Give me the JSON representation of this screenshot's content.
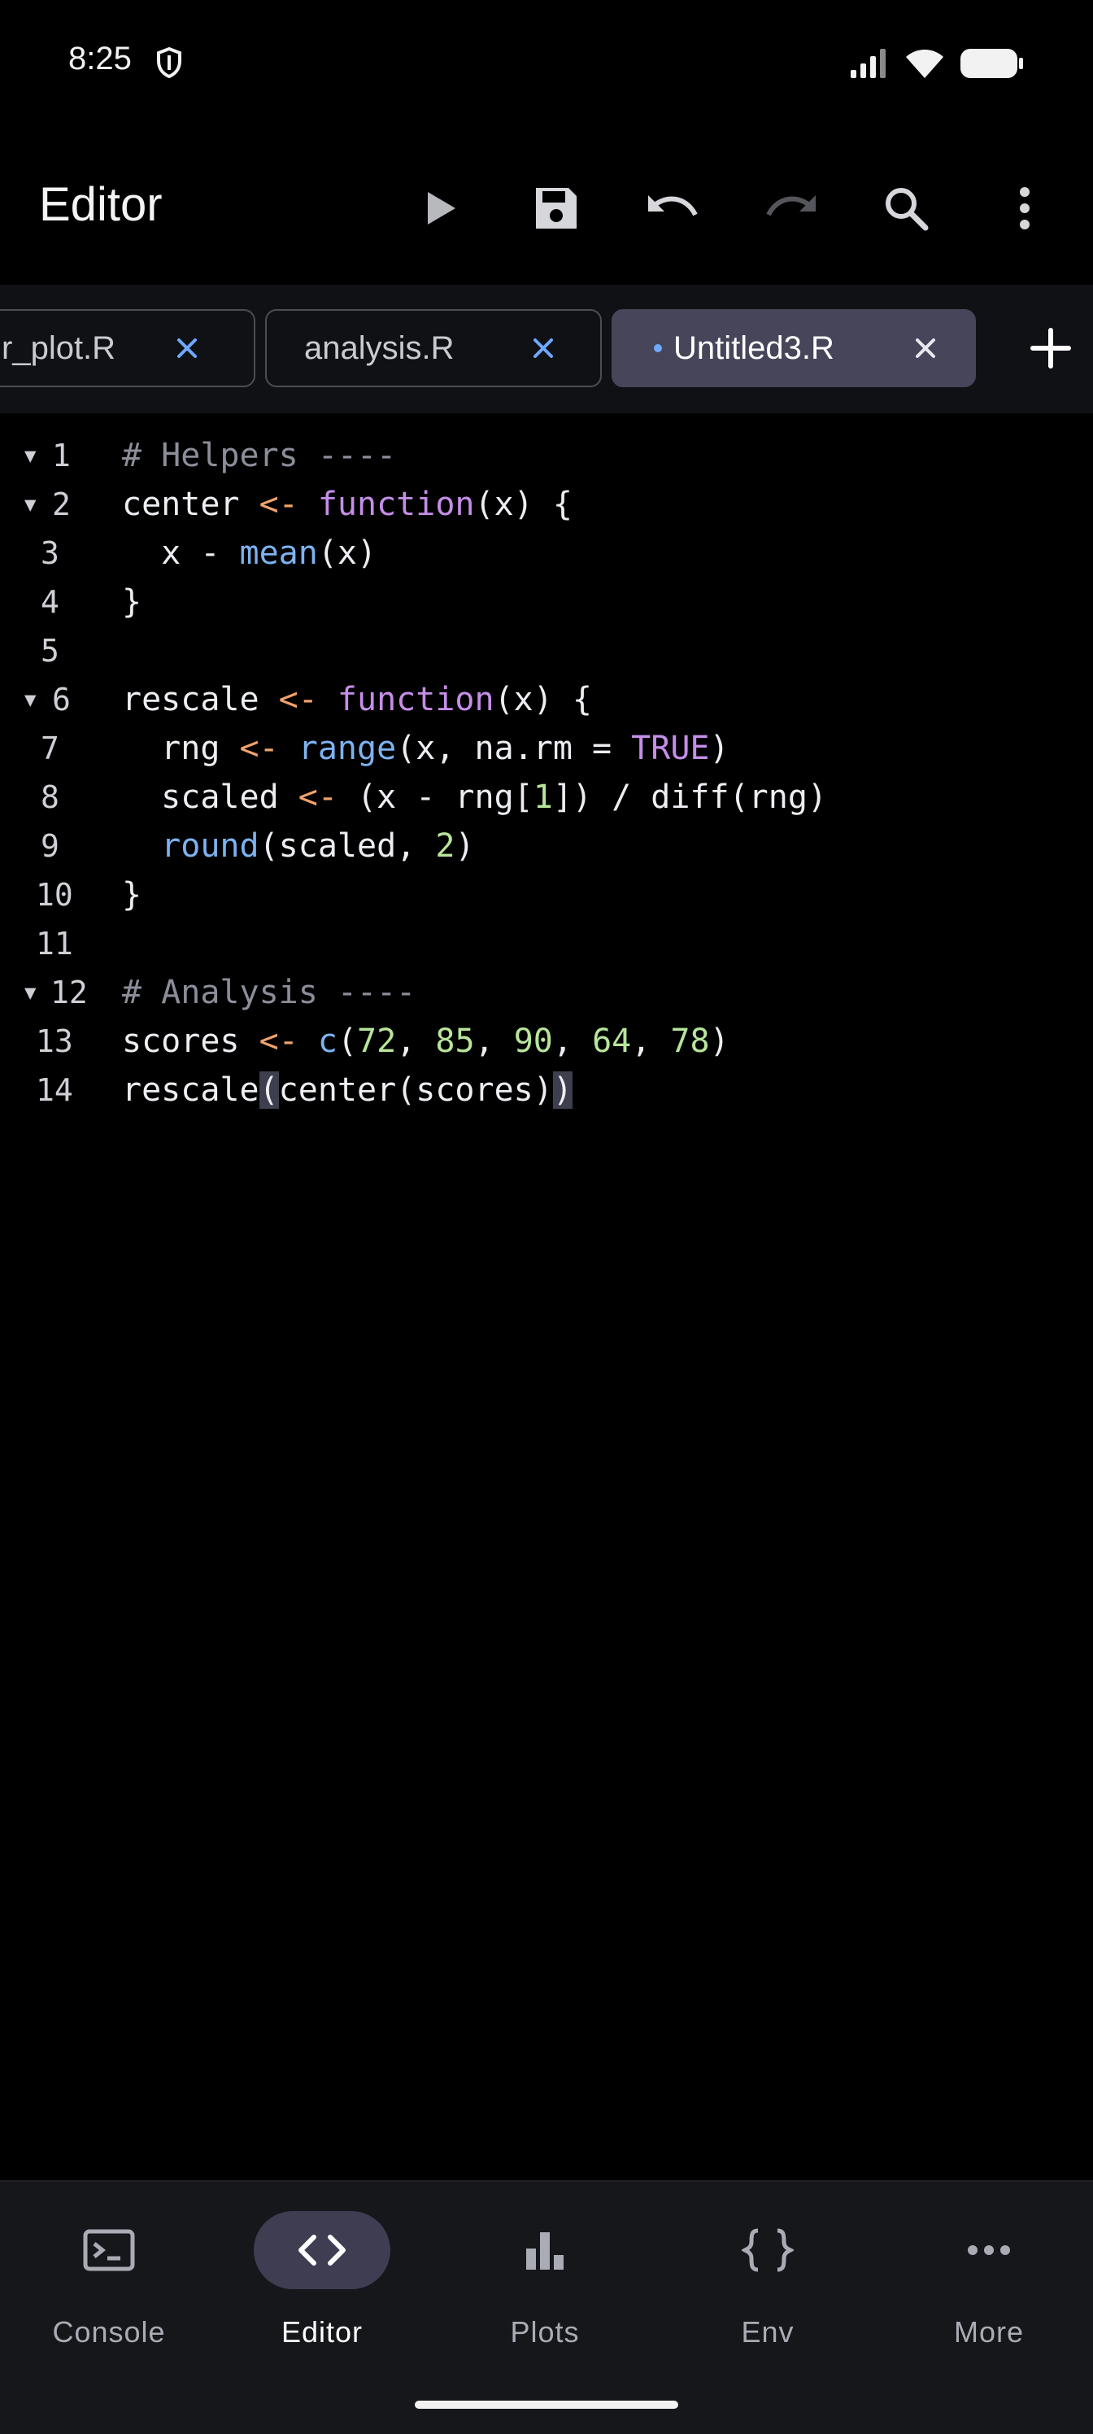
{
  "status_bar": {
    "time": "8:25",
    "icons": [
      "shield-icon",
      "signal-icon",
      "wifi-icon",
      "battery-icon"
    ]
  },
  "app_bar": {
    "title": "Editor",
    "actions": [
      "run-icon",
      "save-icon",
      "undo-icon",
      "redo-icon",
      "search-icon",
      "more-vert-icon"
    ]
  },
  "tabs": [
    {
      "label": "r_plot.R",
      "active": false,
      "modified": false
    },
    {
      "label": "analysis.R",
      "active": false,
      "modified": false
    },
    {
      "label": "Untitled3.R",
      "active": true,
      "modified": true
    }
  ],
  "editor": {
    "lines": [
      {
        "n": "1",
        "fold": true,
        "text": "# Helpers ----"
      },
      {
        "n": "2",
        "fold": true,
        "text": "center <- function(x) {"
      },
      {
        "n": "3",
        "fold": false,
        "text": "  x - mean(x)"
      },
      {
        "n": "4",
        "fold": false,
        "text": "}"
      },
      {
        "n": "5",
        "fold": false,
        "text": ""
      },
      {
        "n": "6",
        "fold": true,
        "text": "rescale <- function(x) {"
      },
      {
        "n": "7",
        "fold": false,
        "text": "  rng <- range(x, na.rm = TRUE)"
      },
      {
        "n": "8",
        "fold": false,
        "text": "  scaled <- (x - rng[1]) / diff(rng)"
      },
      {
        "n": "9",
        "fold": false,
        "text": "  round(scaled, 2)"
      },
      {
        "n": "10",
        "fold": false,
        "text": "}"
      },
      {
        "n": "11",
        "fold": false,
        "text": ""
      },
      {
        "n": "12",
        "fold": true,
        "text": "# Analysis ----"
      },
      {
        "n": "13",
        "fold": false,
        "text": "scores <- c(72, 85, 90, 64, 78)"
      },
      {
        "n": "14",
        "fold": false,
        "text": "rescale(center(scores))"
      }
    ]
  },
  "bottom_nav": [
    {
      "label": "Console",
      "icon": "console-icon",
      "active": false
    },
    {
      "label": "Editor",
      "icon": "code-icon",
      "active": true
    },
    {
      "label": "Plots",
      "icon": "bar-chart-icon",
      "active": false
    },
    {
      "label": "Env",
      "icon": "braces-icon",
      "active": false
    },
    {
      "label": "More",
      "icon": "more-horiz-icon",
      "active": false
    }
  ],
  "colors": {
    "background": "#000000",
    "active_tab": "#46455a",
    "modified_dot": "#6fa8ff",
    "keyword": "#c58ee8",
    "function": "#7db2f0",
    "number": "#b7e59a",
    "assign_op": "#f0a36b",
    "comment": "#8b8e99"
  }
}
